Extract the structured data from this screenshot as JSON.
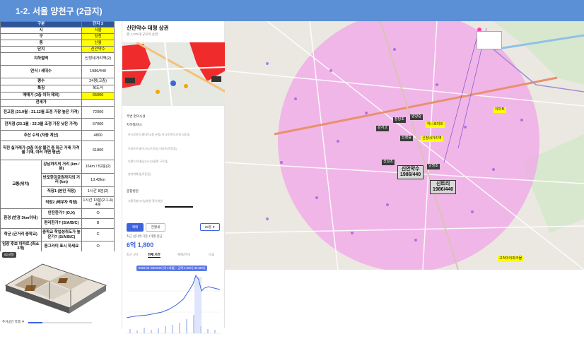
{
  "header": {
    "title": "1-2. 서울 양천구 (2급지)"
  },
  "table": {
    "col_header": "구분",
    "col_value_header": "단지 3",
    "rows": [
      {
        "label": "시",
        "value": "서울",
        "highlight": true
      },
      {
        "label": "구",
        "value": "양천",
        "highlight": true
      },
      {
        "label": "동",
        "value": "신월",
        "highlight": true
      },
      {
        "label": "단지",
        "value": "신안약수",
        "highlight": true
      },
      {
        "label": "지하철역",
        "value": "신정네거리역(2)"
      },
      {
        "label": "연식 / 세대수",
        "value": "1986/440"
      },
      {
        "label": "평수",
        "value": "24평(고층)"
      },
      {
        "label": "특징",
        "value": "복도식"
      },
      {
        "label": "매매가 (3층 이하 제외)",
        "value": "65000",
        "highlight": true
      },
      {
        "label": "전세가",
        "value": ""
      },
      {
        "label": "전고점 (21.9월 - 21.12월 조정 가장 높은 가격)",
        "value": "72000"
      },
      {
        "label": "전저점 (23.1월 - 23.3월 조정 가장 낮은 가격)",
        "value": "57000"
      },
      {
        "label": "추산 수익 (자동 계산)",
        "value": "4800"
      },
      {
        "label": "직전 실거래가 (3층 이상 물건 중 최근 거래 가격을 기재, 여러 개면 평균)",
        "value": "61800"
      }
    ],
    "transport": {
      "group_label": "교통(위치)",
      "rows": [
        {
          "label": "강남까지의 거리 (km / 분)",
          "value": "16km / 52분(2)"
        },
        {
          "label": "반포한강공원까지의 거리 (km)",
          "value": "13.42km"
        },
        {
          "label": "직장1 (본인 직장)",
          "value": "1시간 8분(2)"
        },
        {
          "label": "직장2 (배우자 직장)",
          "value": "1시간 13분(2-1-4) 4분"
        }
      ]
    },
    "environment": {
      "group_label": "환경 (반경 3km이내)",
      "rows": [
        {
          "label": "안전한가? (O,X)",
          "value": "O"
        },
        {
          "label": "편리한가? (S/A/B/C)",
          "value": "B"
        }
      ]
    },
    "school": {
      "group_label": "학군 (근거리 중학교)",
      "rows": [
        {
          "label": "중학교 학업성취도가 높은가? (S/A/B/C)",
          "value": "C"
        }
      ]
    },
    "apartment": {
      "group_label": "임장 후보 아파트 (최소 3개)",
      "rows": [
        {
          "label": "동그라미 표시 하세요",
          "value": "O"
        }
      ]
    }
  },
  "floorplan": {
    "label": "82㎡형",
    "footer": "주거공간 뷰룸 ▼"
  },
  "mid_panel": {
    "title": "신안약수 대형 상권",
    "subtitle": "총 1,375개 규모의 상권",
    "section_transit": "주변 편의시설",
    "subway_label": "지하철/버스",
    "items": [
      "하나로마트(홈마트)(원 본점)  하나로마트(신정시장점)",
      "이마트트레이더스(구로점)  이마트(목동점)",
      "이랜드리테일(2001아울렛 구로점)",
      "현대백화점(목동점)"
    ],
    "section_hospital": "종합병원",
    "hospital_items": "서울특별시서남병원  홍익병원",
    "btn_trade": "매매",
    "btn_rent": "전월세",
    "select_area": "25평 ▼",
    "price_caption": "최근 실거래 기준 1개월 평균",
    "price": "6억 1,800",
    "tabs": [
      "최근 3년",
      "전체 기간",
      "매매/전세",
      "비교"
    ],
    "chart_tooltip": "2022.04~2023.05 (약 1개월) · 금액 2,000 (-32.55%)"
  },
  "map": {
    "pills": [
      {
        "text": "장당초",
        "style": "dark"
      },
      {
        "text": "양강중",
        "style": "dark"
      },
      {
        "text": "하나로마트",
        "style": "yellow"
      },
      {
        "text": "이마트",
        "style": "yellow"
      },
      {
        "text": "강서고",
        "style": "dark"
      },
      {
        "text": "신정중",
        "style": "dark"
      },
      {
        "text": "신정네거리역",
        "style": "yellow"
      },
      {
        "text": "신남초",
        "style": "dark"
      },
      {
        "text": "남명초",
        "style": "dark"
      },
      {
        "text": "고척아이파크몰",
        "style": "yellow"
      }
    ],
    "complexes": [
      {
        "name": "신안약수",
        "info": "1986/440"
      },
      {
        "name": "신트리",
        "info": "1986/440"
      }
    ]
  },
  "colors": {
    "header": "#5b8fd6",
    "table_header": "#2f5597",
    "highlight": "#ffff00",
    "circle_fill": "#f2a6e8",
    "accent": "#3d63dd"
  }
}
